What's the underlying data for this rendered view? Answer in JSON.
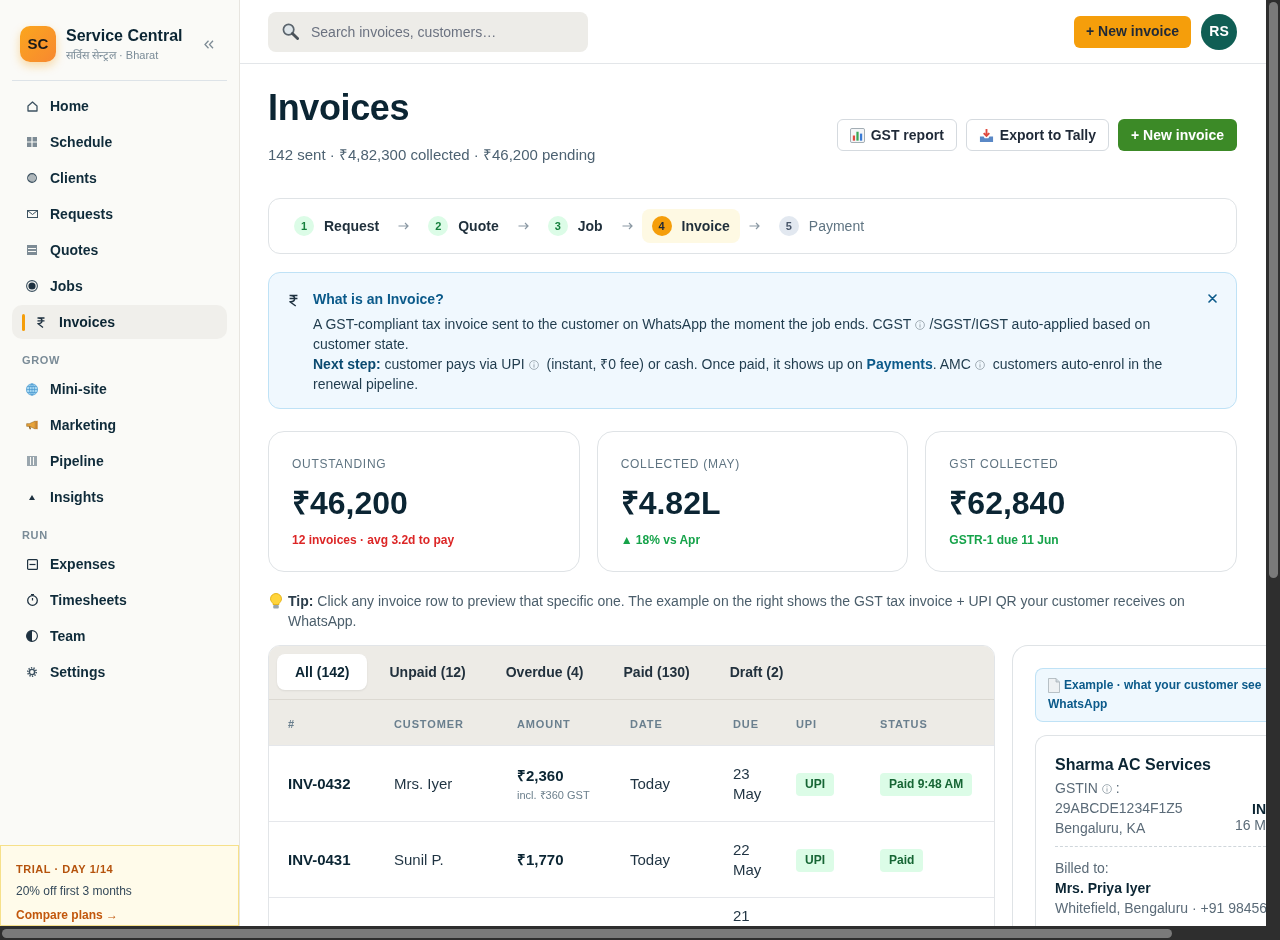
{
  "sidebar": {
    "brand": {
      "logo": "SC",
      "name": "Service Central",
      "tagline": "सर्विस सेन्ट्रल · Bharat"
    },
    "sections": [
      {
        "items": [
          {
            "label": "Home",
            "selected": false
          },
          {
            "label": "Schedule",
            "selected": false
          },
          {
            "label": "Clients",
            "selected": false
          },
          {
            "label": "Requests",
            "selected": false
          },
          {
            "label": "Quotes",
            "selected": false
          },
          {
            "label": "Jobs",
            "selected": false
          },
          {
            "label": "Invoices",
            "selected": true
          }
        ]
      },
      {
        "heading": "GROW",
        "items": [
          {
            "label": "Mini-site",
            "selected": false
          },
          {
            "label": "Marketing",
            "selected": false
          },
          {
            "label": "Pipeline",
            "selected": false
          },
          {
            "label": "Insights",
            "selected": false
          }
        ]
      },
      {
        "heading": "RUN",
        "items": [
          {
            "label": "Expenses",
            "selected": false
          },
          {
            "label": "Timesheets",
            "selected": false
          },
          {
            "label": "Team",
            "selected": false
          },
          {
            "label": "Settings",
            "selected": false
          }
        ]
      }
    ],
    "trial": {
      "title": "TRIAL · DAY 1/14",
      "offer": "20% off first 3 months",
      "link": "Compare plans →"
    }
  },
  "topbar": {
    "search": {
      "placeholder": "Search invoices, customers…"
    },
    "new_button": "+ New invoice",
    "avatar": "RS"
  },
  "page": {
    "title": "Invoices",
    "summary": "142 sent · ₹4,82,300 collected · ₹46,200 pending",
    "actions": [
      {
        "label": "GST report",
        "kind": "report"
      },
      {
        "label": "Export to Tally",
        "kind": "export"
      },
      {
        "label": "+ New invoice",
        "kind": "create"
      }
    ]
  },
  "steps": [
    {
      "number": "1",
      "label": "Request",
      "done": true,
      "selected": false
    },
    {
      "number": "2",
      "label": "Quote",
      "done": true,
      "selected": false
    },
    {
      "number": "3",
      "label": "Job",
      "done": true,
      "selected": false
    },
    {
      "number": "4",
      "label": "Invoice",
      "done": false,
      "selected": true
    },
    {
      "number": "5",
      "label": "Payment",
      "done": false,
      "selected": false
    }
  ],
  "info": {
    "title": "What is an Invoice?",
    "paragraphs": [
      [
        {
          "kind": "text",
          "text": "A GST-compliant tax invoice sent to the customer on WhatsApp the moment the job ends. CGST"
        },
        {
          "kind": "hint"
        },
        {
          "kind": "text",
          "text": "/SGST/IGST auto-applied based on customer state."
        }
      ],
      [
        {
          "kind": "text",
          "text": "**Next step:** customer pays via UPI"
        },
        {
          "kind": "hint"
        },
        {
          "kind": "text",
          "text": " (instant, ₹0 fee) or cash. Once paid, it shows up on "
        },
        {
          "kind": "link",
          "text": "Payments"
        },
        {
          "kind": "text",
          "text": ". AMC"
        },
        {
          "kind": "hint"
        },
        {
          "kind": "text",
          "text": " customers auto-enrol in the renewal pipeline."
        }
      ]
    ]
  },
  "stats": [
    {
      "label": "OUTSTANDING",
      "value": "₹46,200",
      "note": "12 invoices · avg 3.2d to pay",
      "color": "#dc2626"
    },
    {
      "label": "COLLECTED (MAY)",
      "value": "₹4.82L",
      "note": "▲ 18% vs Apr",
      "color": "#16a34a"
    },
    {
      "label": "GST COLLECTED",
      "value": "₹62,840",
      "note": "GSTR-1 due 11 Jun",
      "color": "#16a34a"
    }
  ],
  "tip": "**Tip:** Click any invoice row to preview that specific one. The example on the right shows the GST tax invoice + UPI QR your customer receives on WhatsApp.",
  "table": {
    "tabs": [
      {
        "label": "All (142)",
        "selected": true
      },
      {
        "label": "Unpaid (12)",
        "selected": false
      },
      {
        "label": "Overdue (4)",
        "selected": false
      },
      {
        "label": "Paid (130)",
        "selected": false
      },
      {
        "label": "Draft (2)",
        "selected": false
      }
    ],
    "columns": [
      "#",
      "CUSTOMER",
      "AMOUNT",
      "DATE",
      "DUE",
      "UPI",
      "STATUS"
    ],
    "rows": [
      {
        "number": "INV-0432",
        "customer": "Mrs. Iyer",
        "amount": "₹2,360",
        "amount_note": "incl. ₹360 GST",
        "date": "Today",
        "due": "23 May",
        "upi": "UPI",
        "status": {
          "text": "Paid 9:48 AM",
          "kind": "paid"
        }
      },
      {
        "number": "INV-0431",
        "customer": "Sunil P.",
        "amount": "₹1,770",
        "date": "Today",
        "due": "22 May",
        "upi": "UPI",
        "status": {
          "text": "Paid",
          "kind": "paid"
        }
      },
      {
        "due": "21"
      }
    ]
  },
  "preview": {
    "caption": [
      "Example · what your customer see",
      "WhatsApp"
    ],
    "invoice": {
      "business": "Sharma AC Services",
      "gstin": [
        {
          "kind": "text",
          "text": "GSTIN"
        },
        {
          "kind": "hint"
        },
        {
          "kind": "text",
          "text": ": 29ABCDE1234F1Z5"
        }
      ],
      "city": "Bengaluru, KA",
      "right_column": [
        "IN",
        "16 M"
      ],
      "billed_label": "Billed to:",
      "customer": "Mrs. Priya Iyer",
      "address": "Whitefield, Bengaluru · +91 98456"
    }
  }
}
